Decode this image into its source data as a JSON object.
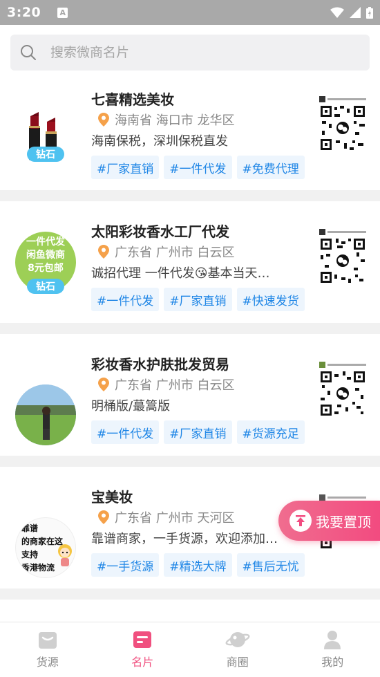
{
  "status_bar": {
    "time": "3:20",
    "notification_letter": "A"
  },
  "search": {
    "placeholder": "搜索微商名片"
  },
  "cards": [
    {
      "title": "七喜精选美妆",
      "location": "海南省 海口市 龙华区",
      "description": "海南保税，深圳保税直发",
      "tags": [
        "#厂家直销",
        "#一件代发",
        "#免费代理"
      ],
      "badge": "钻石",
      "avatar_icon": "lipstick-avatar"
    },
    {
      "title": "太阳彩妆香水工厂代发",
      "location": "广东省 广州市 白云区",
      "description": "诚招代理 一件代发😘基本当天…",
      "tags": [
        "#一件代发",
        "#厂家直销",
        "#快速发货"
      ],
      "badge": "钻石",
      "avatar_icon": "green-text-avatar",
      "avatar_text": [
        "一件代发",
        "闲鱼微商",
        "8元包邮"
      ]
    },
    {
      "title": "彩妆香水护肤批发贸易",
      "location": "广东省 广州市 白云区",
      "description": "明桶版/蕞篙版",
      "tags": [
        "#一件代发",
        "#厂家直销",
        "#货源充足"
      ],
      "avatar_icon": "landscape-photo-avatar"
    },
    {
      "title": "宝美妆",
      "location": "广东省 广州市 天河区",
      "description": "靠谱商家，一手货源，欢迎添加…",
      "tags": [
        "#一手货源",
        "#精选大牌",
        "#售后无忧"
      ],
      "avatar_icon": "handwritten-avatar",
      "avatar_text": [
        "靠谱",
        "的商家在这",
        "支持",
        "香港物流"
      ]
    }
  ],
  "float_button": {
    "label": "我要置顶"
  },
  "tabbar": {
    "items": [
      {
        "label": "货源",
        "icon": "box-icon",
        "active": false
      },
      {
        "label": "名片",
        "icon": "card-icon",
        "active": true
      },
      {
        "label": "商圈",
        "icon": "planet-icon",
        "active": false
      },
      {
        "label": "我的",
        "icon": "user-icon",
        "active": false
      }
    ]
  },
  "colors": {
    "accent": "#f0507f",
    "tag_text": "#1f86e6",
    "tag_bg": "#edf5fd",
    "badge": "#4fc2f0",
    "location_pin": "#f5a14a"
  }
}
